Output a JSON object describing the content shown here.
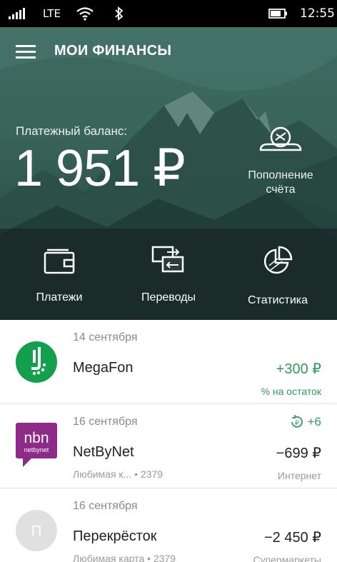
{
  "status_bar": {
    "network": "LTE",
    "time": "12:55"
  },
  "header": {
    "title": "МОИ ФИНАНСЫ"
  },
  "balance": {
    "label": "Платежный баланс:",
    "amount": "1 951 ₽"
  },
  "topup": {
    "line1": "Пополнение",
    "line2": "счёта"
  },
  "actions": [
    {
      "label": "Платежи",
      "icon": "wallet-icon"
    },
    {
      "label": "Переводы",
      "icon": "transfer-icon"
    },
    {
      "label": "Статистика",
      "icon": "pie-chart-icon"
    }
  ],
  "transactions": [
    {
      "date": "14 сентября",
      "name": "MegaFon",
      "subtitle": "",
      "amount": "+300 ₽",
      "category": "% на остаток",
      "logo": "megafon-logo"
    },
    {
      "date": "16 сентября",
      "name": "NetByNet",
      "subtitle": "Любимая к... • 2379",
      "amount": "−699 ₽",
      "category": "Интернет",
      "bonus": "+6",
      "logo": "netbynet-logo",
      "logo_text": "nbn",
      "logo_subtext": "netbynet"
    },
    {
      "date": "16 сентября",
      "name": "Перекрёсток",
      "subtitle": "Любимая карта • 2379",
      "amount": "−2 450 ₽",
      "category": "Супермаркеты",
      "logo": "placeholder-logo",
      "logo_text": "П"
    }
  ],
  "colors": {
    "positive": "#2e9c5a",
    "megafon": "#13a04c",
    "netbynet": "#8e2a88"
  }
}
